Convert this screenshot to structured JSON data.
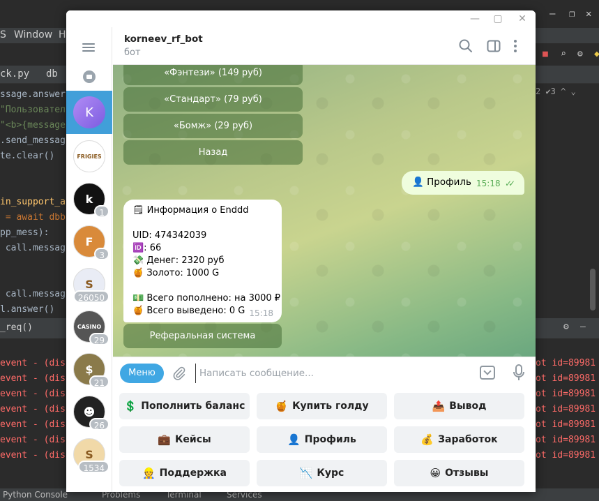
{
  "ide": {
    "menu": [
      "S",
      "Window",
      "Hel"
    ],
    "tabs": [
      "ck.py",
      "db"
    ],
    "code": [
      {
        "text": "ssage.answer(",
        "cls": ""
      },
      {
        "text": "\"Пользовател",
        "cls": "c-str"
      },
      {
        "text": "\"<b>{message",
        "cls": "c-str"
      },
      {
        "text": ".send_messag",
        "cls": ""
      },
      {
        "text": "te.clear()",
        "cls": ""
      },
      {
        "text": "",
        "cls": ""
      },
      {
        "text": "",
        "cls": ""
      },
      {
        "text": "in_support_a",
        "cls": "c-fn"
      },
      {
        "text": " = await dbb",
        "cls": "c-kw"
      },
      {
        "text": "pp_mess):",
        "cls": ""
      },
      {
        "text": " call.messag",
        "cls": ""
      },
      {
        "text": "",
        "cls": ""
      },
      {
        "text": "",
        "cls": ""
      },
      {
        "text": " call.messag",
        "cls": ""
      },
      {
        "text": "l.answer()",
        "cls": ""
      }
    ],
    "run_title": "_req()",
    "error_left": "event - (dis",
    "error_right": "ot id=89981",
    "error_rows": 7,
    "gutter_info": "2 ✔3 ^ ⌄",
    "bottom_tabs": [
      "Python Console",
      "Problems",
      "Terminal",
      "Services"
    ]
  },
  "telegram": {
    "bot_name": "korneev_rf_bot",
    "bot_status": "бот",
    "active_chat_initial": "K",
    "chats": [
      {
        "name": "frigies",
        "label": "FRIGIES",
        "badge": "",
        "color": "#ffffff"
      },
      {
        "name": "k-chat",
        "label": "k",
        "badge": "1",
        "color": "#111111"
      },
      {
        "name": "f-chat",
        "label": "F",
        "badge": "3",
        "color": "#d98a3a"
      },
      {
        "name": "s-chat",
        "label": "S",
        "badge": "26050",
        "color": "#e9ecf5"
      },
      {
        "name": "casino-chat",
        "label": "CASINO",
        "badge": "29",
        "color": "#555555"
      },
      {
        "name": "money-chat",
        "label": "$",
        "badge": "21",
        "color": "#8a7a4a"
      },
      {
        "name": "mask-chat",
        "label": "☻",
        "badge": "26",
        "color": "#222222"
      },
      {
        "name": "s-gold-chat",
        "label": "S",
        "badge": "1534",
        "color": "#f1d9a8"
      }
    ],
    "inline_buttons": [
      "«Фэнтези» (149 руб)",
      "«Стандарт» (79 руб)",
      "«Бомж» (29 руб)",
      "Назад"
    ],
    "outgoing": {
      "text": "👤 Профиль",
      "time": "15:18",
      "ticks": "✓✓"
    },
    "incoming": {
      "title": "🗒 Информация о Enddd",
      "uid": "UID: 474342039",
      "id_line": "🆔: 66",
      "money": "💸 Денег: 2320 руб",
      "gold": "🍯 Золото: 1000 G",
      "deposited": "💵 Всего пополнено: на 3000 ₽",
      "withdrawn": "🍯 Всего выведено: 0 G",
      "time": "15:18"
    },
    "referral_button": "Реферальная система",
    "input": {
      "menu": "Меню",
      "placeholder": "Написать сообщение..."
    },
    "keyboard": [
      {
        "icon": "💲",
        "label": "Пополнить баланс"
      },
      {
        "icon": "🍯",
        "label": "Купить голду"
      },
      {
        "icon": "📤",
        "label": "Вывод"
      },
      {
        "icon": "💼",
        "label": "Кейсы"
      },
      {
        "icon": "👤",
        "label": "Профиль"
      },
      {
        "icon": "💰",
        "label": "Заработок"
      },
      {
        "icon": "👷",
        "label": "Поддержка"
      },
      {
        "icon": "📉",
        "label": "Курс"
      },
      {
        "icon": "😀",
        "label": "Отзывы"
      }
    ]
  }
}
